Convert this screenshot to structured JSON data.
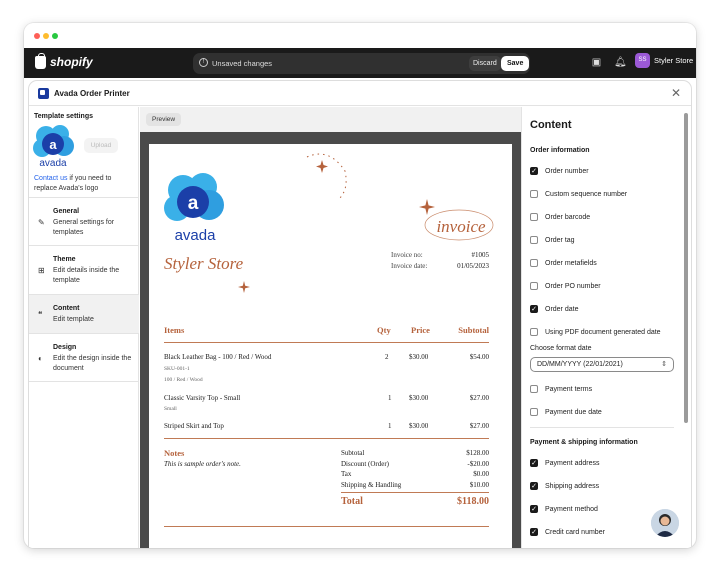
{
  "topbar": {
    "brand": "shopify",
    "unsaved": "Unsaved changes",
    "discard": "Discard",
    "save": "Save",
    "avatar_initials": "SS",
    "store_name": "Styler Store"
  },
  "app": {
    "title": "Avada Order Printer"
  },
  "left": {
    "template_settings": "Template settings",
    "logo_text": "avada",
    "upload": "Upload",
    "contact_link": "Contact us",
    "contact_rest": " if you need to replace Avada's logo",
    "nav": [
      {
        "title": "General",
        "desc": "General settings for templates",
        "icon": "edit-icon"
      },
      {
        "title": "Theme",
        "desc": "Edit details inside the template",
        "icon": "layout-icon"
      },
      {
        "title": "Content",
        "desc": "Edit template",
        "icon": "quote-icon"
      },
      {
        "title": "Design",
        "desc": "Edit the design inside the document",
        "icon": "palette-icon"
      }
    ]
  },
  "preview": {
    "tab": "Preview",
    "logo_text": "avada",
    "store_name": "Styler Store",
    "invoice_word": "invoice",
    "invoice_no_label": "Invoice no:",
    "invoice_no": "#1005",
    "invoice_date_label": "Invoice date:",
    "invoice_date": "01/05/2023",
    "headers": {
      "items": "Items",
      "qty": "Qty",
      "price": "Price",
      "subtotal": "Subtotal"
    },
    "rows": [
      {
        "name": "Black Leather Bag - 100 / Red / Wood",
        "sub1": "SKU-001-1",
        "sub2": "100 / Red / Wood",
        "qty": "2",
        "price": "$30.00",
        "subtotal": "$54.00"
      },
      {
        "name": "Classic Varsity Top - Small",
        "sub1": "Small",
        "sub2": "",
        "qty": "1",
        "price": "$30.00",
        "subtotal": "$27.00"
      },
      {
        "name": "Striped Skirt and Top",
        "sub1": "",
        "sub2": "",
        "qty": "1",
        "price": "$30.00",
        "subtotal": "$27.00"
      }
    ],
    "notes_label": "Notes",
    "notes_text": "This is sample order's note.",
    "totals": [
      {
        "label": "Subtotal",
        "value": "$128.00"
      },
      {
        "label": "Discount (Order)",
        "value": "-$20.00"
      },
      {
        "label": "Tax",
        "value": "$0.00"
      },
      {
        "label": "Shipping & Handling",
        "value": "$10.00"
      }
    ],
    "total_label": "Total",
    "total_value": "$118.00",
    "accent_color": "#b5623c"
  },
  "content": {
    "title": "Content",
    "order_info": "Order information",
    "options": [
      {
        "label": "Order number",
        "checked": true
      },
      {
        "label": "Custom sequence number",
        "checked": false
      },
      {
        "label": "Order barcode",
        "checked": false
      },
      {
        "label": "Order tag",
        "checked": false
      },
      {
        "label": "Order metafields",
        "checked": false
      },
      {
        "label": "Order PO number",
        "checked": false
      },
      {
        "label": "Order date",
        "checked": true
      },
      {
        "label": "Using PDF document generated date",
        "checked": false
      }
    ],
    "format_label": "Choose format date",
    "format_value": "DD/MM/YYYY (22/01/2021)",
    "options2": [
      {
        "label": "Payment terms",
        "checked": false
      },
      {
        "label": "Payment due date",
        "checked": false
      }
    ],
    "payship": "Payment & shipping information",
    "options3": [
      {
        "label": "Payment address",
        "checked": true
      },
      {
        "label": "Shipping address",
        "checked": true
      },
      {
        "label": "Payment method",
        "checked": true
      },
      {
        "label": "Credit card number",
        "checked": true
      }
    ]
  }
}
